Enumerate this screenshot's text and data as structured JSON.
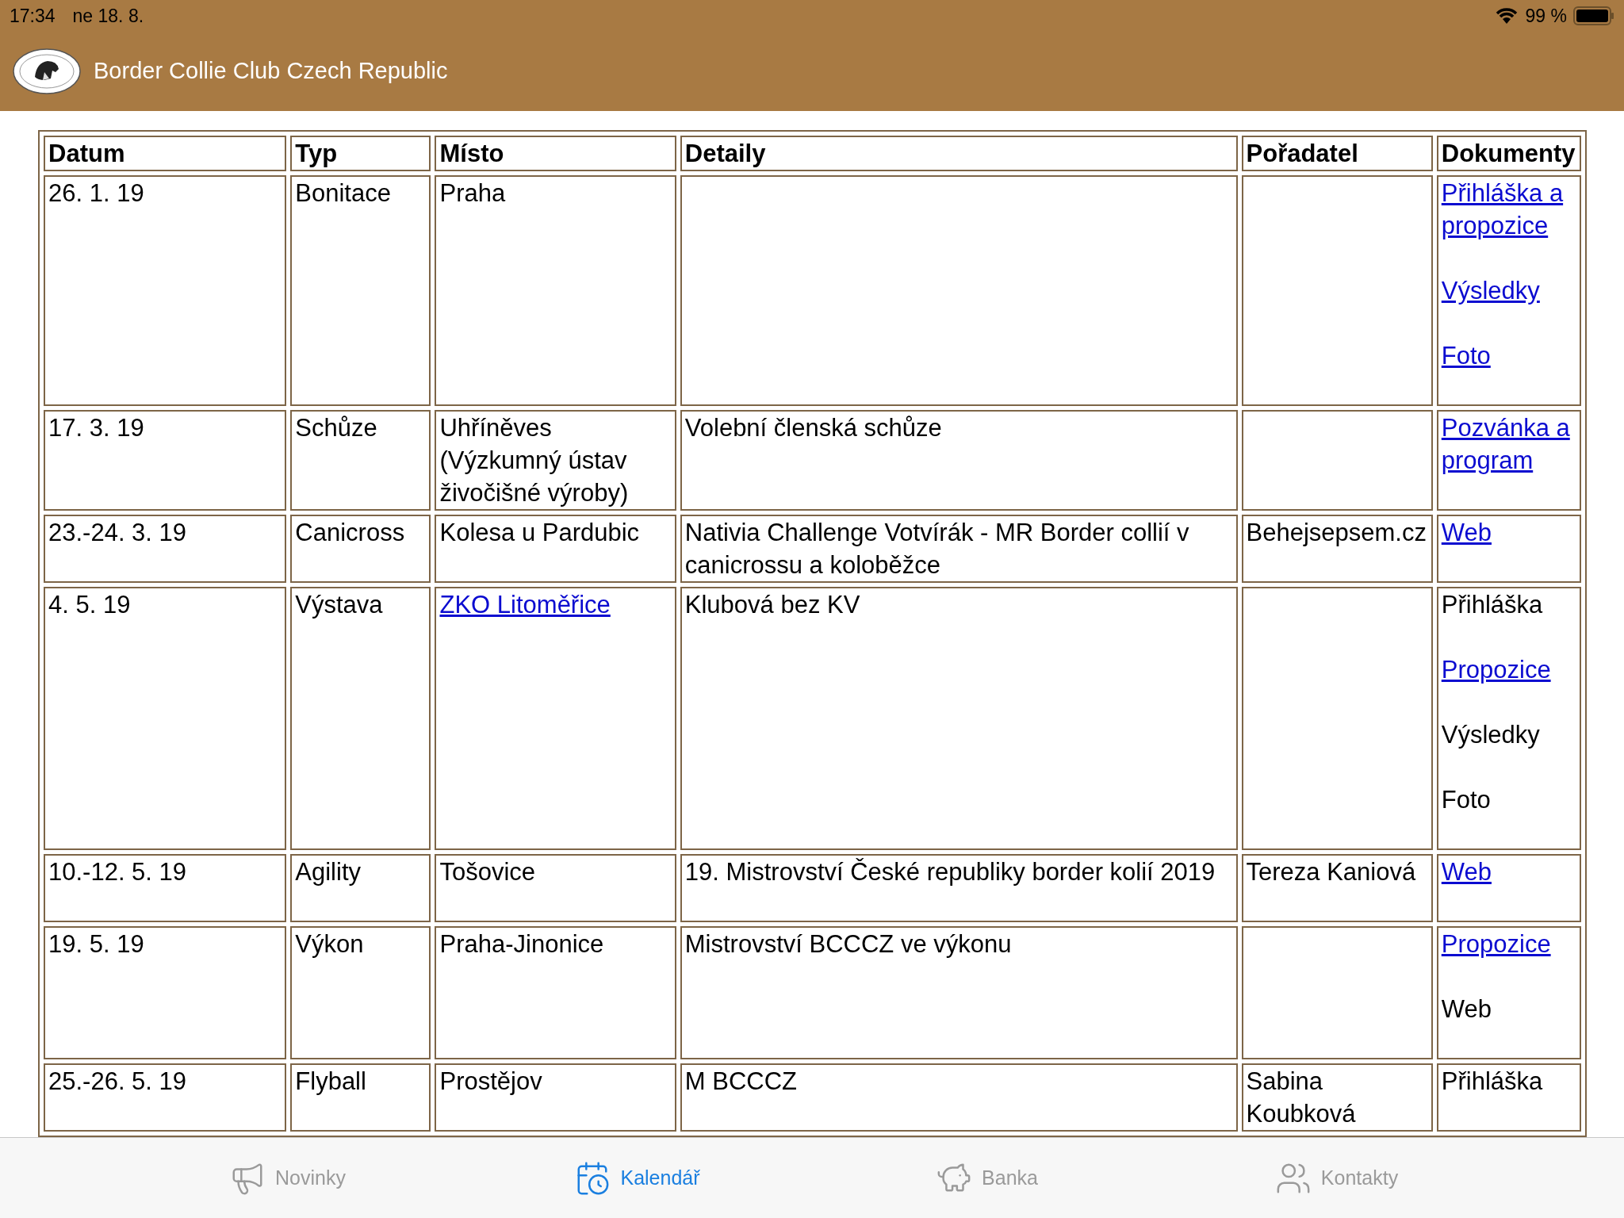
{
  "status_bar": {
    "time": "17:34",
    "date": "ne 18. 8.",
    "battery": "99 %"
  },
  "header": {
    "title": "Border Collie Club Czech Republic"
  },
  "table": {
    "columns": [
      "Datum",
      "Typ",
      "Místo",
      "Detaily",
      "Pořadatel",
      "Dokumenty"
    ],
    "rows": [
      {
        "datum": "26. 1. 19",
        "typ": "Bonitace",
        "misto": {
          "text": "Praha",
          "link": false
        },
        "detaily": "",
        "poradatel": "",
        "docs": [
          {
            "text": "Přihláška a propozice",
            "link": true
          },
          {
            "text": "Výsledky",
            "link": true
          },
          {
            "text": "Foto",
            "link": true
          }
        ]
      },
      {
        "datum": "17. 3. 19",
        "typ": "Schůze",
        "misto": {
          "text": "Uhříněves (Výzkumný ústav živočišné výroby)",
          "link": false
        },
        "detaily": "Volební členská schůze",
        "poradatel": "",
        "docs": [
          {
            "text": "Pozvánka a program",
            "link": true
          }
        ]
      },
      {
        "datum": "23.-24. 3. 19",
        "typ": "Canicross",
        "misto": {
          "text": "Kolesa u Pardubic",
          "link": false
        },
        "detaily": "Nativia Challenge Votvírák - MR Border collií v canicrossu a koloběžce",
        "poradatel": "Behejsepsem.cz",
        "docs": [
          {
            "text": "Web",
            "link": true
          }
        ]
      },
      {
        "datum": "4. 5. 19",
        "typ": "Výstava",
        "misto": {
          "text": "ZKO Litoměřice",
          "link": true
        },
        "detaily": "Klubová bez KV",
        "poradatel": "",
        "docs": [
          {
            "text": "Přihláška",
            "link": false
          },
          {
            "text": "Propozice",
            "link": true
          },
          {
            "text": "Výsledky",
            "link": false
          },
          {
            "text": "Foto",
            "link": false
          }
        ]
      },
      {
        "datum": "10.-12. 5. 19",
        "typ": "Agility",
        "misto": {
          "text": "Tošovice",
          "link": false
        },
        "detaily": "19. Mistrovství České republiky border kolií 2019",
        "poradatel": "Tereza Kaniová",
        "docs": [
          {
            "text": "Web",
            "link": true
          }
        ]
      },
      {
        "datum": "19. 5. 19",
        "typ": "Výkon",
        "misto": {
          "text": "Praha-Jinonice",
          "link": false
        },
        "detaily": "Mistrovství BCCCZ ve výkonu",
        "poradatel": "",
        "docs": [
          {
            "text": "Propozice",
            "link": true
          },
          {
            "text": "Web",
            "link": false
          }
        ]
      },
      {
        "datum": "25.-26. 5. 19",
        "typ": "Flyball",
        "misto": {
          "text": "Prostějov",
          "link": false
        },
        "detaily": "M BCCCZ",
        "poradatel": "Sabina Koubková",
        "docs": [
          {
            "text": "Přihláška",
            "link": false
          }
        ]
      }
    ]
  },
  "tab_bar": [
    {
      "label": "Novinky",
      "kind": "megaphone",
      "selected": false
    },
    {
      "label": "Kalendář",
      "kind": "calendar",
      "selected": true
    },
    {
      "label": "Banka",
      "kind": "piggybank",
      "selected": false
    },
    {
      "label": "Kontakty",
      "kind": "contacts",
      "selected": false
    }
  ]
}
